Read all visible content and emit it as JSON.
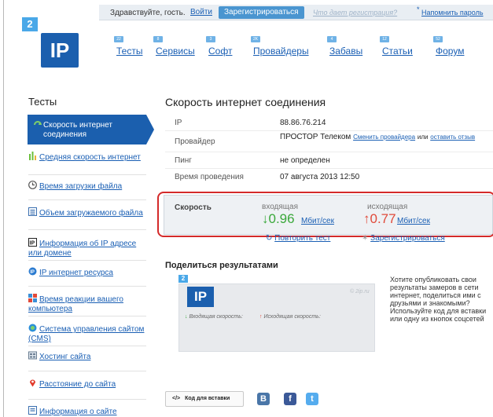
{
  "header": {
    "greeting": "Здравствуйте, гость.",
    "login": "Войти",
    "register": "Зарегистрироваться",
    "why_register": "Что дает регистрация?",
    "remind_password": "Напомнить пароль",
    "logo_tag": "2",
    "logo_text": "IP"
  },
  "nav": {
    "items": [
      {
        "label": "Тесты",
        "badge": "22"
      },
      {
        "label": "Сервисы",
        "badge": "8"
      },
      {
        "label": "Софт",
        "badge": "3"
      },
      {
        "label": "Провайдеры",
        "badge": "2K"
      },
      {
        "label": "Забавы",
        "badge": "4"
      },
      {
        "label": "Статьи",
        "badge": "12"
      },
      {
        "label": "Форум",
        "badge": "52"
      }
    ]
  },
  "sidebar": {
    "title": "Тесты",
    "active": "Скорость интернет соединения",
    "items": [
      {
        "label": "Средняя скорость интернет",
        "icon": "bars-icon"
      },
      {
        "label": "Время загрузки файла",
        "icon": "clock-icon"
      },
      {
        "label": "Объем загружаемого файла",
        "icon": "file-size-icon"
      },
      {
        "label": "Информация об IP адресе или домене",
        "icon": "ip-icon"
      },
      {
        "label": "IP интернет ресурса",
        "icon": "globe-icon"
      },
      {
        "label": "Время реакции вашего компьютера",
        "icon": "reaction-icon"
      },
      {
        "label": "Система управления сайтом (CMS)",
        "icon": "cms-icon"
      },
      {
        "label": "Хостинг сайта",
        "icon": "hosting-icon"
      },
      {
        "label": "Расстояние до сайта",
        "icon": "location-pin-icon"
      },
      {
        "label": "Информация о сайте",
        "icon": "site-info-icon"
      }
    ]
  },
  "main": {
    "title": "Скорость интернет соединения",
    "rows": [
      {
        "label": "IP",
        "value": "88.86.76.214"
      },
      {
        "label": "Провайдер",
        "value": "ПРОСТОР Телеком",
        "link1": "Сменить провайдера",
        "or": "или",
        "link2": "оставить отзыв"
      },
      {
        "label": "Пинг",
        "value": "не определен"
      },
      {
        "label": "Время проведения",
        "value": "07 августа 2013 12:50"
      }
    ],
    "speed": {
      "label": "Скорость",
      "in_label": "входящая",
      "in_arrow": "↓",
      "in_value": "0.96",
      "in_unit": "Мбит/сек",
      "out_label": "исходящая",
      "out_arrow": "↑",
      "out_value": "0.77",
      "out_unit": "Мбит/сек"
    },
    "retest": "Повторить тест",
    "register": "Зарегистрироваться",
    "share": {
      "title": "Поделиться результатами",
      "widget_tag": "2",
      "widget_logo": "IP",
      "widget_copy": "© 2ip.ru",
      "widget_in": "Входящая скорость:",
      "widget_out": "Исходящая скорость:",
      "text": "Хотите опубликовать свои результаты замеров в сети интернет, поделиться ими с друзьями и знакомыми? Используйте код для вставки или одну из кнопок соцсетей",
      "embed": "Код для вставки",
      "embed_symbol": "</>"
    }
  },
  "colors": {
    "accent": "#1b5fae",
    "link": "#1a5fb4",
    "incoming": "#3aa83a",
    "outgoing": "#e04a3a",
    "highlight": "#d42a2a"
  }
}
